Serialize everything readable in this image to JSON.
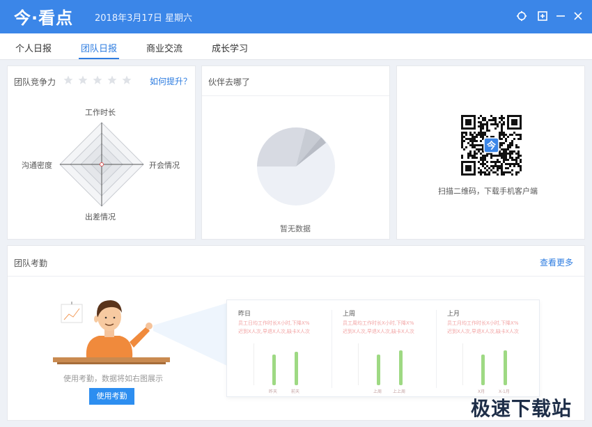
{
  "app": {
    "logo": "今·看点",
    "date": "2018年3月17日 星期六"
  },
  "tabs": [
    {
      "label": "个人日报",
      "active": false
    },
    {
      "label": "团队日报",
      "active": true
    },
    {
      "label": "商业交流",
      "active": false
    },
    {
      "label": "成长学习",
      "active": false
    }
  ],
  "competitiveness": {
    "title": "团队竞争力",
    "stars_filled": 0,
    "stars_total": 5,
    "improve_link": "如何提升？",
    "radar": {
      "top": "工作时长",
      "right": "开会情况",
      "bottom": "出差情况",
      "left": "沟通密度"
    }
  },
  "partners": {
    "title": "伙伴去哪了",
    "empty_text": "暂无数据"
  },
  "qr": {
    "badge": "今",
    "caption": "扫描二维码，下载手机客户端"
  },
  "attendance": {
    "title": "团队考勤",
    "more_link": "查看更多",
    "hint": "使用考勤，数据将如右图展示",
    "use_button": "使用考勤",
    "preview": [
      {
        "title": "昨日",
        "line1": "员工日均工作时长X小时,下降X%",
        "line2": "迟到X人次,早退X人次,缺卡X人次",
        "bars": [
          0.78,
          0.86
        ],
        "labels": [
          "昨天",
          "前天"
        ]
      },
      {
        "title": "上周",
        "line1": "员工周均工作时长X小时,下降X%",
        "line2": "迟到X人次,早退X人次,缺卡X人次",
        "bars": [
          0.78,
          0.9
        ],
        "labels": [
          "上周",
          "上上周"
        ]
      },
      {
        "title": "上月",
        "line1": "员工月均工作时长X小时,下降X%",
        "line2": "迟到X人次,早退X人次,缺卡X人次",
        "bars": [
          0.78,
          0.9
        ],
        "labels": [
          "X月",
          "X-1月"
        ]
      }
    ]
  },
  "watermark": "极速下载站",
  "colors": {
    "primary": "#3b86e8",
    "link": "#2d7ce0",
    "bar": "#9ed983"
  }
}
